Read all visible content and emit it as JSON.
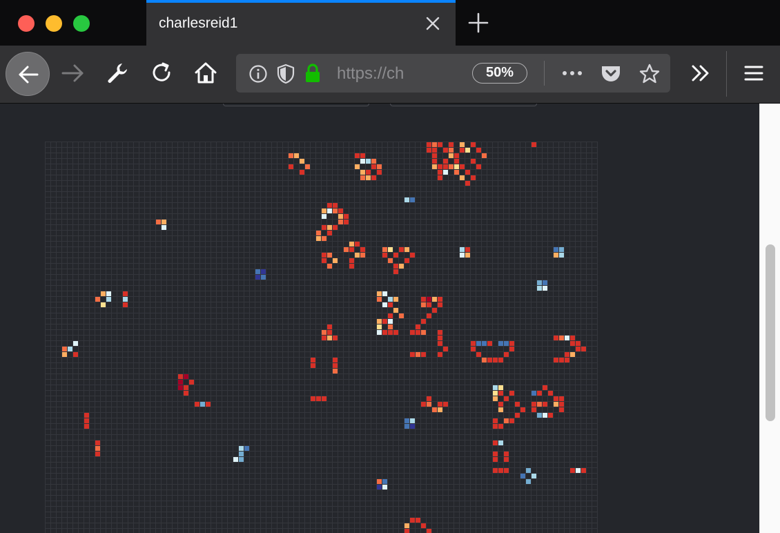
{
  "browser": {
    "tab_title": "charlesreid1",
    "url": "https://ch",
    "zoom": "50%"
  },
  "icons": [
    "close-icon",
    "new-tab-icon",
    "back-icon",
    "forward-icon",
    "wrench-icon",
    "reload-icon",
    "home-icon",
    "info-icon",
    "shield-icon",
    "lock-icon",
    "more-icon",
    "pocket-icon",
    "bookmark-star-icon",
    "overflow-chevron-icon",
    "menu-icon"
  ],
  "colors": {
    "accent": "#0a84ff",
    "lock": "#12bc00",
    "cell_palette": [
      "#d73027",
      "#f46d43",
      "#fdae61",
      "#fee090",
      "#e0f3f8",
      "#abd9e9",
      "#74add1",
      "#4575b4",
      "#313695",
      "#a50026"
    ]
  },
  "life_grid": {
    "cols": 100,
    "rows": 71,
    "cells": [
      [
        69,
        0,
        0
      ],
      [
        70,
        0,
        1
      ],
      [
        71,
        0,
        0
      ],
      [
        73,
        0,
        0
      ],
      [
        75,
        0,
        2
      ],
      [
        77,
        0,
        0
      ],
      [
        88,
        0,
        0
      ],
      [
        69,
        1,
        0
      ],
      [
        70,
        1,
        0
      ],
      [
        72,
        1,
        0
      ],
      [
        73,
        1,
        1
      ],
      [
        75,
        1,
        0
      ],
      [
        76,
        1,
        3
      ],
      [
        78,
        1,
        0
      ],
      [
        44,
        2,
        1
      ],
      [
        45,
        2,
        2
      ],
      [
        56,
        2,
        0
      ],
      [
        57,
        2,
        0
      ],
      [
        70,
        2,
        0
      ],
      [
        73,
        2,
        2
      ],
      [
        74,
        2,
        0
      ],
      [
        79,
        2,
        1
      ],
      [
        46,
        3,
        2
      ],
      [
        57,
        3,
        4
      ],
      [
        58,
        3,
        5
      ],
      [
        59,
        3,
        1
      ],
      [
        70,
        3,
        0
      ],
      [
        72,
        3,
        0
      ],
      [
        74,
        3,
        0
      ],
      [
        77,
        3,
        0
      ],
      [
        44,
        4,
        0
      ],
      [
        47,
        4,
        1
      ],
      [
        56,
        4,
        2
      ],
      [
        59,
        4,
        0
      ],
      [
        60,
        4,
        1
      ],
      [
        70,
        4,
        2
      ],
      [
        71,
        4,
        0
      ],
      [
        72,
        4,
        0
      ],
      [
        73,
        4,
        1
      ],
      [
        74,
        4,
        3
      ],
      [
        75,
        4,
        0
      ],
      [
        78,
        4,
        0
      ],
      [
        46,
        5,
        0
      ],
      [
        57,
        5,
        2
      ],
      [
        58,
        5,
        0
      ],
      [
        60,
        5,
        0
      ],
      [
        71,
        5,
        0
      ],
      [
        72,
        5,
        4
      ],
      [
        74,
        5,
        1
      ],
      [
        76,
        5,
        0
      ],
      [
        57,
        6,
        1
      ],
      [
        58,
        6,
        2
      ],
      [
        59,
        6,
        0
      ],
      [
        71,
        6,
        0
      ],
      [
        75,
        6,
        2
      ],
      [
        77,
        6,
        0
      ],
      [
        76,
        7,
        0
      ],
      [
        65,
        10,
        5
      ],
      [
        66,
        10,
        7
      ],
      [
        51,
        11,
        0
      ],
      [
        52,
        11,
        0
      ],
      [
        50,
        12,
        2
      ],
      [
        51,
        12,
        4
      ],
      [
        52,
        12,
        1
      ],
      [
        53,
        12,
        0
      ],
      [
        50,
        13,
        4
      ],
      [
        53,
        13,
        2
      ],
      [
        54,
        13,
        0
      ],
      [
        53,
        14,
        1
      ],
      [
        54,
        14,
        0
      ],
      [
        20,
        14,
        1
      ],
      [
        21,
        14,
        2
      ],
      [
        21,
        15,
        4
      ],
      [
        51,
        15,
        2
      ],
      [
        52,
        15,
        0
      ],
      [
        50,
        15,
        0
      ],
      [
        49,
        16,
        1
      ],
      [
        51,
        16,
        0
      ],
      [
        49,
        17,
        2
      ],
      [
        50,
        17,
        1
      ],
      [
        55,
        18,
        2
      ],
      [
        56,
        18,
        0
      ],
      [
        54,
        19,
        1
      ],
      [
        55,
        19,
        0
      ],
      [
        57,
        19,
        0
      ],
      [
        61,
        19,
        1
      ],
      [
        62,
        19,
        3
      ],
      [
        64,
        19,
        0
      ],
      [
        65,
        19,
        2
      ],
      [
        75,
        19,
        5
      ],
      [
        76,
        19,
        0
      ],
      [
        92,
        19,
        7
      ],
      [
        93,
        19,
        6
      ],
      [
        50,
        20,
        0
      ],
      [
        51,
        20,
        1
      ],
      [
        56,
        20,
        2
      ],
      [
        57,
        20,
        1
      ],
      [
        61,
        20,
        0
      ],
      [
        63,
        20,
        0
      ],
      [
        66,
        20,
        0
      ],
      [
        75,
        20,
        4
      ],
      [
        76,
        20,
        2
      ],
      [
        92,
        20,
        2
      ],
      [
        93,
        20,
        5
      ],
      [
        50,
        21,
        0
      ],
      [
        52,
        21,
        2
      ],
      [
        55,
        21,
        0
      ],
      [
        62,
        21,
        1
      ],
      [
        65,
        21,
        0
      ],
      [
        51,
        22,
        1
      ],
      [
        55,
        22,
        0
      ],
      [
        63,
        22,
        0
      ],
      [
        64,
        22,
        2
      ],
      [
        38,
        23,
        7
      ],
      [
        39,
        23,
        8
      ],
      [
        38,
        24,
        8
      ],
      [
        39,
        24,
        7
      ],
      [
        63,
        23,
        0
      ],
      [
        89,
        25,
        6
      ],
      [
        90,
        25,
        7
      ],
      [
        89,
        26,
        5
      ],
      [
        90,
        26,
        4
      ],
      [
        10,
        27,
        2
      ],
      [
        11,
        27,
        4
      ],
      [
        14,
        27,
        0
      ],
      [
        9,
        28,
        1
      ],
      [
        11,
        28,
        5
      ],
      [
        14,
        28,
        5
      ],
      [
        60,
        27,
        2
      ],
      [
        61,
        27,
        4
      ],
      [
        60,
        28,
        1
      ],
      [
        62,
        28,
        5
      ],
      [
        63,
        28,
        2
      ],
      [
        10,
        29,
        3
      ],
      [
        14,
        29,
        0
      ],
      [
        61,
        29,
        4
      ],
      [
        62,
        29,
        0
      ],
      [
        68,
        28,
        0
      ],
      [
        69,
        28,
        9
      ],
      [
        70,
        28,
        2
      ],
      [
        71,
        28,
        0
      ],
      [
        68,
        29,
        1
      ],
      [
        69,
        29,
        0
      ],
      [
        71,
        29,
        0
      ],
      [
        70,
        30,
        0
      ],
      [
        63,
        30,
        2
      ],
      [
        62,
        31,
        0
      ],
      [
        64,
        31,
        1
      ],
      [
        51,
        33,
        0
      ],
      [
        50,
        34,
        1
      ],
      [
        51,
        34,
        0
      ],
      [
        50,
        35,
        0
      ],
      [
        51,
        35,
        2
      ],
      [
        52,
        35,
        0
      ],
      [
        60,
        32,
        2
      ],
      [
        61,
        32,
        0
      ],
      [
        62,
        32,
        4
      ],
      [
        60,
        33,
        3
      ],
      [
        62,
        33,
        1
      ],
      [
        60,
        34,
        4
      ],
      [
        61,
        34,
        0
      ],
      [
        62,
        34,
        0
      ],
      [
        63,
        34,
        0
      ],
      [
        67,
        33,
        0
      ],
      [
        66,
        34,
        0
      ],
      [
        67,
        34,
        0
      ],
      [
        68,
        34,
        1
      ],
      [
        71,
        34,
        0
      ],
      [
        71,
        35,
        0
      ],
      [
        71,
        36,
        0
      ],
      [
        72,
        37,
        0
      ],
      [
        68,
        32,
        0
      ],
      [
        69,
        31,
        0
      ],
      [
        70,
        30,
        0
      ],
      [
        93,
        35,
        1
      ],
      [
        94,
        35,
        4
      ],
      [
        95,
        35,
        0
      ],
      [
        92,
        35,
        0
      ],
      [
        95,
        36,
        0
      ],
      [
        96,
        36,
        0
      ],
      [
        5,
        36,
        4
      ],
      [
        3,
        37,
        1
      ],
      [
        4,
        37,
        5
      ],
      [
        3,
        38,
        2
      ],
      [
        5,
        38,
        0
      ],
      [
        77,
        36,
        0
      ],
      [
        78,
        36,
        7
      ],
      [
        79,
        36,
        7
      ],
      [
        80,
        36,
        0
      ],
      [
        82,
        36,
        7
      ],
      [
        83,
        36,
        7
      ],
      [
        84,
        36,
        0
      ],
      [
        77,
        37,
        0
      ],
      [
        84,
        37,
        0
      ],
      [
        96,
        37,
        0
      ],
      [
        97,
        37,
        0
      ],
      [
        78,
        38,
        0
      ],
      [
        83,
        38,
        0
      ],
      [
        94,
        38,
        0
      ],
      [
        95,
        38,
        2
      ],
      [
        79,
        39,
        1
      ],
      [
        80,
        39,
        0
      ],
      [
        81,
        39,
        0
      ],
      [
        82,
        39,
        0
      ],
      [
        92,
        39,
        0
      ],
      [
        93,
        39,
        0
      ],
      [
        94,
        39,
        0
      ],
      [
        66,
        38,
        0
      ],
      [
        67,
        38,
        1
      ],
      [
        68,
        38,
        0
      ],
      [
        71,
        38,
        0
      ],
      [
        48,
        39,
        0
      ],
      [
        52,
        39,
        0
      ],
      [
        48,
        40,
        0
      ],
      [
        52,
        40,
        0
      ],
      [
        52,
        41,
        1
      ],
      [
        24,
        42,
        0
      ],
      [
        25,
        42,
        9
      ],
      [
        24,
        43,
        9
      ],
      [
        26,
        43,
        0
      ],
      [
        24,
        44,
        9
      ],
      [
        25,
        44,
        0
      ],
      [
        25,
        45,
        0
      ],
      [
        81,
        44,
        5
      ],
      [
        82,
        44,
        3
      ],
      [
        81,
        45,
        3
      ],
      [
        82,
        45,
        0
      ],
      [
        81,
        46,
        2
      ],
      [
        83,
        46,
        0
      ],
      [
        84,
        45,
        0
      ],
      [
        88,
        45,
        7
      ],
      [
        89,
        45,
        0
      ],
      [
        90,
        44,
        0
      ],
      [
        91,
        45,
        0
      ],
      [
        92,
        46,
        0
      ],
      [
        93,
        46,
        0
      ],
      [
        48,
        46,
        0
      ],
      [
        49,
        46,
        0
      ],
      [
        50,
        46,
        0
      ],
      [
        69,
        46,
        0
      ],
      [
        69,
        47,
        1
      ],
      [
        72,
        47,
        0
      ],
      [
        82,
        47,
        0
      ],
      [
        85,
        47,
        0
      ],
      [
        88,
        47,
        0
      ],
      [
        93,
        47,
        0
      ],
      [
        27,
        47,
        0
      ],
      [
        28,
        47,
        6
      ],
      [
        29,
        47,
        0
      ],
      [
        68,
        47,
        0
      ],
      [
        71,
        47,
        0
      ],
      [
        89,
        47,
        1
      ],
      [
        90,
        47,
        0
      ],
      [
        92,
        47,
        2
      ],
      [
        70,
        48,
        1
      ],
      [
        71,
        48,
        2
      ],
      [
        82,
        48,
        2
      ],
      [
        86,
        48,
        0
      ],
      [
        88,
        48,
        0
      ],
      [
        93,
        48,
        0
      ],
      [
        85,
        49,
        0
      ],
      [
        89,
        49,
        6
      ],
      [
        90,
        49,
        4
      ],
      [
        91,
        49,
        0
      ],
      [
        7,
        49,
        0
      ],
      [
        7,
        50,
        0
      ],
      [
        7,
        51,
        0
      ],
      [
        65,
        50,
        7
      ],
      [
        66,
        50,
        5
      ],
      [
        65,
        51,
        7
      ],
      [
        66,
        51,
        8
      ],
      [
        81,
        50,
        0
      ],
      [
        83,
        50,
        1
      ],
      [
        84,
        50,
        0
      ],
      [
        82,
        51,
        0
      ],
      [
        81,
        51,
        0
      ],
      [
        9,
        54,
        0
      ],
      [
        9,
        55,
        1
      ],
      [
        9,
        56,
        0
      ],
      [
        81,
        54,
        0
      ],
      [
        82,
        54,
        5
      ],
      [
        35,
        55,
        5
      ],
      [
        36,
        55,
        7
      ],
      [
        35,
        56,
        6
      ],
      [
        34,
        57,
        4
      ],
      [
        35,
        57,
        6
      ],
      [
        81,
        56,
        0
      ],
      [
        83,
        56,
        0
      ],
      [
        81,
        57,
        0
      ],
      [
        83,
        57,
        0
      ],
      [
        87,
        59,
        6
      ],
      [
        86,
        60,
        7
      ],
      [
        88,
        60,
        5
      ],
      [
        87,
        61,
        6
      ],
      [
        81,
        59,
        0
      ],
      [
        82,
        59,
        0
      ],
      [
        83,
        59,
        0
      ],
      [
        95,
        59,
        0
      ],
      [
        96,
        59,
        4
      ],
      [
        97,
        59,
        0
      ],
      [
        60,
        61,
        1
      ],
      [
        61,
        61,
        7
      ],
      [
        60,
        62,
        8
      ],
      [
        61,
        62,
        4
      ],
      [
        67,
        68,
        0
      ],
      [
        66,
        68,
        0
      ],
      [
        65,
        69,
        2
      ],
      [
        68,
        69,
        0
      ],
      [
        65,
        70,
        0
      ],
      [
        69,
        70,
        0
      ]
    ]
  }
}
